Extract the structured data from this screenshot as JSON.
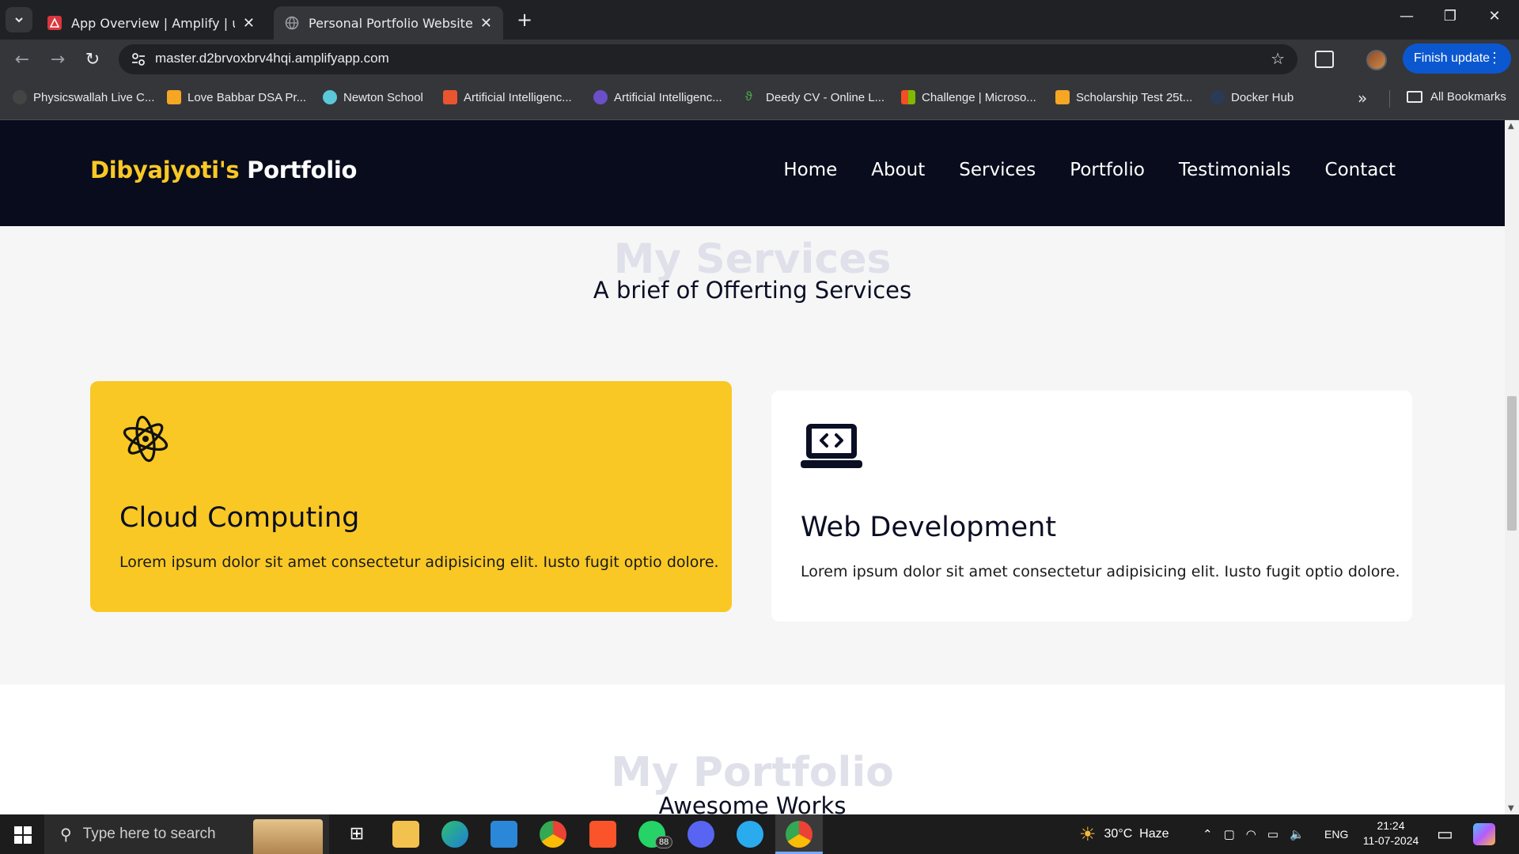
{
  "browser": {
    "tabs": [
      {
        "title": "App Overview | Amplify | us-eas",
        "active": false
      },
      {
        "title": "Personal Portfolio Website | Dib",
        "active": true
      }
    ],
    "url": "master.d2brvoxbrv4hqi.amplifyapp.com",
    "finish_update": "Finish update",
    "bookmarks": [
      "Physicswallah Live C...",
      "Love Babbar DSA Pr...",
      "Newton School",
      "Artificial Intelligenc...",
      "Artificial Intelligenc...",
      "Deedy CV - Online L...",
      "Challenge | Microso...",
      "Scholarship Test 25t...",
      "Docker Hub"
    ],
    "all_bookmarks": "All Bookmarks"
  },
  "site": {
    "logo_first": "Dibyajyoti's",
    "logo_second": "Portfolio",
    "nav": [
      "Home",
      "About",
      "Services",
      "Portfolio",
      "Testimonials",
      "Contact"
    ],
    "services_title": "My Services",
    "services_subtitle": "A brief of Offerting Services",
    "cards": [
      {
        "title": "Cloud Computing",
        "desc": "Lorem ipsum dolor sit amet consectetur adipisicing elit. Iusto fugit optio dolore.",
        "icon": "atom-icon"
      },
      {
        "title": "Web Development",
        "desc": "Lorem ipsum dolor sit amet consectetur adipisicing elit. Iusto fugit optio dolore.",
        "icon": "laptop-code-icon"
      }
    ],
    "portfolio_title": "My Portfolio",
    "portfolio_subtitle": "Awesome Works",
    "colors": {
      "accent": "#f9c824",
      "header_bg": "#080c1c",
      "muted_title": "#dfe0ea"
    }
  },
  "taskbar": {
    "search_placeholder": "Type here to search",
    "whatsapp_badge": "88",
    "weather": "30°C  Haze",
    "language": "ENG",
    "time": "21:24",
    "date": "11-07-2024"
  }
}
